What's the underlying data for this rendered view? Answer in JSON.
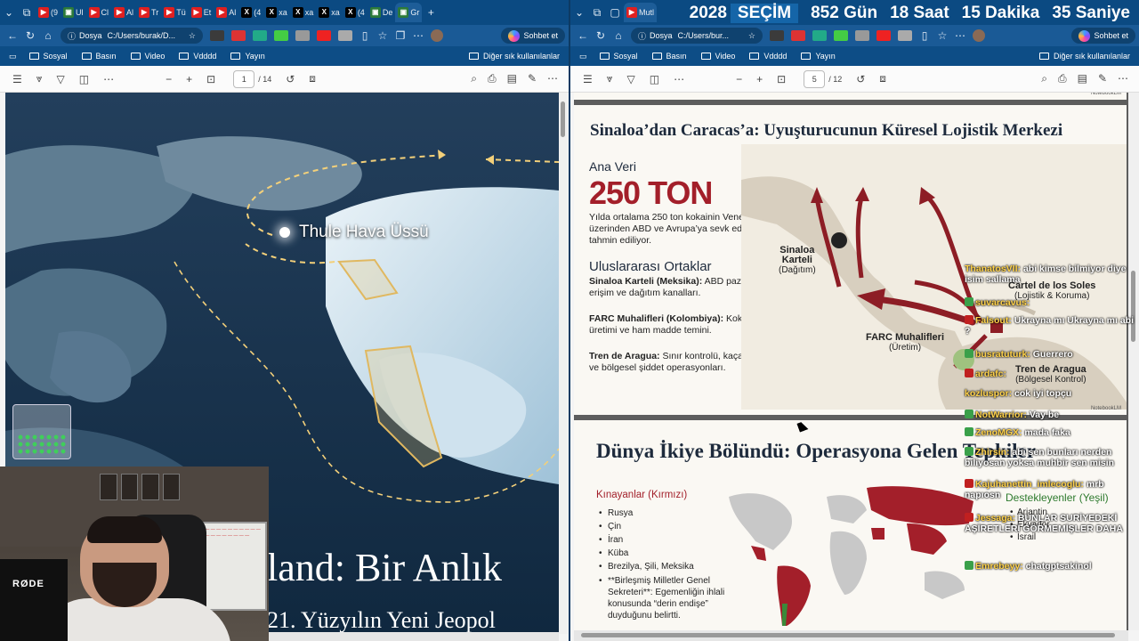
{
  "left_window": {
    "tabs": [
      {
        "icon": "youtube",
        "label": "(9"
      },
      {
        "icon": "generic",
        "label": "Ul"
      },
      {
        "icon": "youtube",
        "label": "Cl"
      },
      {
        "icon": "youtube",
        "label": "Al"
      },
      {
        "icon": "youtube",
        "label": "Tr"
      },
      {
        "icon": "youtube",
        "label": "Tü"
      },
      {
        "icon": "youtube",
        "label": "Et"
      },
      {
        "icon": "youtube",
        "label": "Al"
      },
      {
        "icon": "x",
        "label": "(4"
      },
      {
        "icon": "x",
        "label": "xa"
      },
      {
        "icon": "x",
        "label": "xa"
      },
      {
        "icon": "x",
        "label": "xa"
      },
      {
        "icon": "x",
        "label": "(4"
      },
      {
        "icon": "generic",
        "label": "De"
      },
      {
        "icon": "generic",
        "label": "Gr"
      }
    ],
    "address": "C:/Users/burak/D...",
    "address_prefix": "Dosya",
    "copilot": "Sohbet et",
    "bookmarks": [
      "Sosyal",
      "Basın",
      "Video",
      "Vdddd",
      "Yayın"
    ],
    "bookmarks_right": "Diğer sık kullanılanlar",
    "page_current": "1",
    "page_total": "/ 14",
    "slide": {
      "place_label": "Thule Hava Üssü",
      "title": "land: Bir Anlık",
      "subtitle": "21. Yüzyılın Yeni Jeopol"
    },
    "webcam": {
      "mic_brand": "RØDE",
      "board_text": "— — — — — — — — — — — — — — — — — — — —"
    }
  },
  "right_window": {
    "active_tab": "Mutl",
    "countdown": {
      "year": "2028",
      "label": "SEÇİM",
      "days": "852 Gün",
      "hours": "18 Saat",
      "minutes": "15 Dakika",
      "seconds": "35 Saniye"
    },
    "address": "C:/Users/bur...",
    "address_prefix": "Dosya",
    "copilot": "Sohbet et",
    "bookmarks": [
      "Sosyal",
      "Basın",
      "Video",
      "Vdddd",
      "Yayın"
    ],
    "bookmarks_right": "Diğer sık kullanılanlar",
    "page_current": "5",
    "page_total": "/ 12",
    "notebooklm": "NotebookLM",
    "slide1": {
      "title": "Sinaloa’dan Caracas’a: Uyuşturucunun Küresel Lojistik Merkezi",
      "key_label": "Ana Veri",
      "key_value": "250 TON",
      "key_desc": "Yılda ortalama 250 ton kokainin Venezuela üzerinden ABD ve Avrupa’ya sevk edildiği tahmin ediliyor.",
      "section": "Uluslararası Ortaklar",
      "partners": [
        {
          "name": "Sinaloa Karteli (Meksika):",
          "text": "ABD pazarına erişim ve dağıtım kanalları."
        },
        {
          "name": "FARC Muhalifleri (Kolombiya):",
          "text": "Kokain üretimi ve ham madde temini."
        },
        {
          "name": "Tren de Aragua:",
          "text": "Sınır kontrolü, kaçakçılık ve bölgesel şiddet operasyonları."
        }
      ],
      "map_labels": {
        "sinaloa": "Sinaloa",
        "sinaloa2": "Karteli",
        "sinaloa3": "(Dağıtım)",
        "farc": "FARC Muhalifleri",
        "farc2": "(Üretim)",
        "soles": "Cartel de los Soles",
        "soles2": "(Lojistik & Koruma)",
        "tren": "Tren de Aragua",
        "tren2": "(Bölgesel Kontrol)"
      }
    },
    "slide2": {
      "title": "Dünya İkiye Bölündü: Operasyona Gelen Tepkiler",
      "red_title": "Kınayanlar (Kırmızı)",
      "red_items": [
        "Rusya",
        "Çin",
        "İran",
        "Küba",
        "Brezilya, Şili, Meksika",
        "**Birleşmiş Milletler Genel Sekreteri**: Egemenliğin ihlali konusunda “derin endişe” duyduğunu belirtti."
      ],
      "green_title": "Destekleyenler (Yeşil)",
      "green_items": [
        "Arjantin",
        "Ekvador",
        "İsrail"
      ]
    },
    "chat": [
      {
        "user": "ThanatosVII:",
        "text": "abi kimse bilmiyor diye isim sallama",
        "badge": "none"
      },
      {
        "user": "suvarcavus:",
        "text": "",
        "badge": "green"
      },
      {
        "user": "Falsout:",
        "text": "Ukrayna mı Ukrayna mı abi ?",
        "badge": "red"
      },
      {
        "user": "busratuturk:",
        "text": "Guerrero",
        "badge": "green"
      },
      {
        "user": "ardafc:",
        "text": "",
        "badge": "red"
      },
      {
        "user": "kozluspor:",
        "text": "cok iyi topçu",
        "badge": "none"
      },
      {
        "user": "NotWarrior:",
        "text": "Vay be",
        "badge": "green"
      },
      {
        "user": "ZenoMGX:",
        "text": "mada faka",
        "badge": "green"
      },
      {
        "user": "Zhirsin:",
        "text": "abi sen bunları nerden biliyosan yoksa muhbir sen misin",
        "badge": "green"
      },
      {
        "user": "Kajuhanettin_imlecoglu:",
        "text": "mrb napıosn",
        "badge": "red"
      },
      {
        "user": "Jessaga:",
        "text": "BUNLAR SURİYEDEKİ AŞİRETLERİ GÖRMEMİŞLER DAHA",
        "badge": "red"
      },
      {
        "user": "Emrebeyy:",
        "text": "chatgptsakinol",
        "badge": "green"
      }
    ]
  },
  "colors": {
    "browser_frame": "#0b4a82",
    "accent_red": "#a31f2a",
    "support_green": "#2e7a2e",
    "chat_user": "#ffd24a"
  }
}
